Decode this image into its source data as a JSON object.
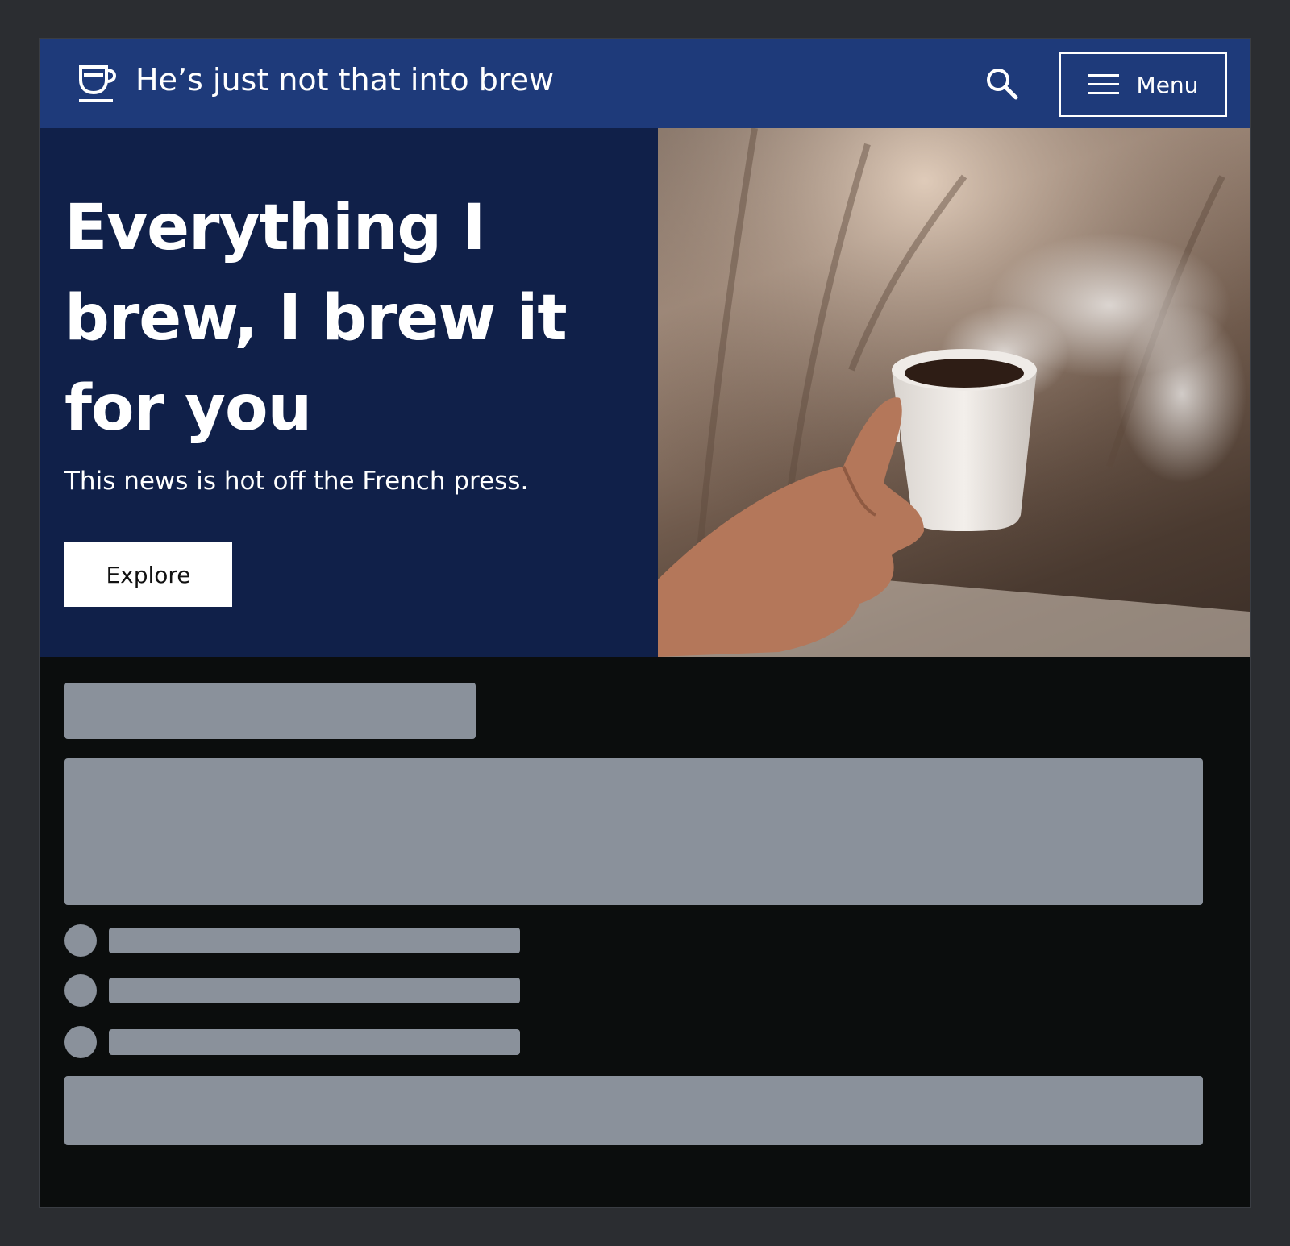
{
  "header": {
    "site_title": "He’s just not that into brew",
    "menu_label": "Menu",
    "logo_icon": "coffee-cup-icon",
    "search_icon": "search-icon",
    "menu_icon": "hamburger-icon"
  },
  "hero": {
    "title": "Everything I brew, I brew it for you",
    "subtitle": "This news is hot off the French press.",
    "cta_label": "Explore"
  },
  "colors": {
    "page_bg": "#2b2d31",
    "header_bg": "#1e3a7a",
    "hero_bg": "#102049",
    "content_bg": "#0b0d0d",
    "skeleton": "#8a919b"
  }
}
